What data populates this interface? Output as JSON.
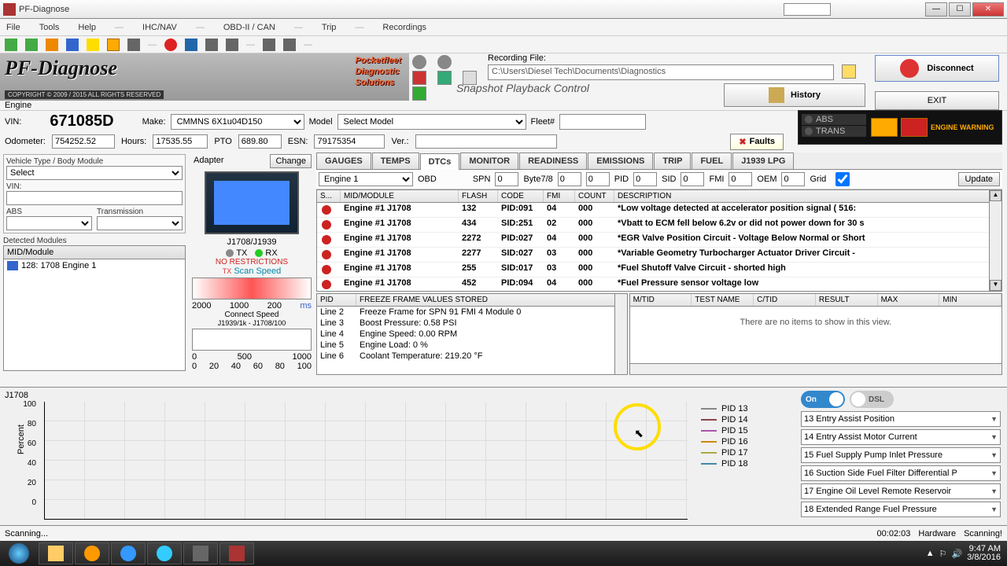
{
  "window": {
    "title": "PF-Diagnose"
  },
  "menus": [
    "File",
    "Tools",
    "Help",
    "IHC/NAV",
    "OBD-II / CAN",
    "Trip",
    "Recordings"
  ],
  "logo": {
    "main": "PF-Diagnose",
    "sub1": "Pocketfleet",
    "sub2": "Diagnostic",
    "sub3": "Solutions",
    "copy": "COPYRIGHT © 2009 / 2015  ALL RIGHTS RESERVED"
  },
  "rec": {
    "label": "Recording File:",
    "path": "C:\\Users\\Diesel Tech\\Documents\\Diagnostics",
    "snap": "Snapshot Playback Control"
  },
  "btns": {
    "disconnect": "Disconnect",
    "history": "History",
    "exit": "EXIT",
    "faults": "Faults",
    "update": "Update",
    "change": "Change"
  },
  "engine_lbl": "Engine",
  "vehicle": {
    "vin_lbl": "VIN:",
    "vin": "671085D",
    "make_lbl": "Make:",
    "make": "CMMNS 6X1u04D150",
    "model_lbl": "Model",
    "model": "Select Model",
    "fleet_lbl": "Fleet#",
    "odo_lbl": "Odometer:",
    "odo": "754252.52",
    "hours_lbl": "Hours:",
    "hours": "17535.55",
    "pto_lbl": "PTO",
    "pto": "689.80",
    "esn_lbl": "ESN:",
    "esn": "79175354",
    "ver_lbl": "Ver.:"
  },
  "ind": {
    "abs": "ABS",
    "trans": "TRANS",
    "ew": "ENGINE WARNING"
  },
  "left": {
    "vt_lbl": "Vehicle Type / Body Module",
    "vt": "Select",
    "vin_lbl": "VIN:",
    "abs": "ABS",
    "trans": "Transmission",
    "det": "Detected Modules",
    "mod_hdr": "MID/Module",
    "mod1": "128: 1708 Engine 1"
  },
  "adapter": {
    "lbl": "Adapter",
    "name": "J1708/J1939",
    "tx": "TX",
    "rx": "RX",
    "nr": "NO RESTRICTIONS",
    "ss": "Scan Speed",
    "g1": [
      "2000",
      "1000",
      "200"
    ],
    "cs": "Connect Speed",
    "cs2": "J1939/1k - J1708/100",
    "g2": [
      "0",
      "500",
      "1000"
    ],
    "g2b": [
      "0",
      "20",
      "40",
      "60",
      "80",
      "100"
    ]
  },
  "tabs": [
    "GAUGES",
    "TEMPS",
    "DTCs",
    "MONITOR",
    "READINESS",
    "EMISSIONS",
    "TRIP",
    "FUEL",
    "J1939 LPG"
  ],
  "active_tab": 2,
  "filt": {
    "eng": "Engine 1",
    "obd": "OBD",
    "spn": "SPN",
    "b78": "Byte7/8",
    "pid": "PID",
    "sid": "SID",
    "fmi": "FMI",
    "oem": "OEM",
    "grid": "Grid",
    "z": "0"
  },
  "dtc_hdr": [
    "S...",
    "MID/MODULE",
    "FLASH",
    "CODE",
    "FMI",
    "COUNT",
    "DESCRIPTION"
  ],
  "dtcs": [
    {
      "m": "Engine #1 J1708",
      "f": "132",
      "c": "PID:091",
      "fmi": "04",
      "cn": "000",
      "d": "*Low voltage detected at accelerator position signal ( 516:"
    },
    {
      "m": "Engine #1 J1708",
      "f": "434",
      "c": "SID:251",
      "fmi": "02",
      "cn": "000",
      "d": "*Vbatt to ECM fell below 6.2v or did not power down for 30 s"
    },
    {
      "m": "Engine #1 J1708",
      "f": "2272",
      "c": "PID:027",
      "fmi": "04",
      "cn": "000",
      "d": "*EGR Valve Position Circuit - Voltage Below Normal or Short"
    },
    {
      "m": "Engine #1 J1708",
      "f": "2277",
      "c": "SID:027",
      "fmi": "03",
      "cn": "000",
      "d": "*Variable Geometry Turbocharger Actuator Driver Circuit -"
    },
    {
      "m": "Engine #1 J1708",
      "f": "255",
      "c": "SID:017",
      "fmi": "03",
      "cn": "000",
      "d": "*Fuel Shutoff Valve Circuit - shorted high"
    },
    {
      "m": "Engine #1 J1708",
      "f": "452",
      "c": "PID:094",
      "fmi": "04",
      "cn": "000",
      "d": "*Fuel Pressure sensor voltage low"
    }
  ],
  "ff_hdr": [
    "PID",
    "FREEZE FRAME VALUES STORED"
  ],
  "ff": [
    {
      "l": "Line 2",
      "v": "Freeze Frame for SPN 91 FMI 4 Module 0"
    },
    {
      "l": "Line 3",
      "v": "Boost Pressure: 0.58 PSI"
    },
    {
      "l": "Line 4",
      "v": "Engine Speed: 0.00 RPM"
    },
    {
      "l": "Line 5",
      "v": "Engine Load: 0 %"
    },
    {
      "l": "Line 6",
      "v": "Coolant Temperature: 219.20 °F"
    }
  ],
  "tests_hdr": [
    "M/TID",
    "TEST NAME",
    "C/TID",
    "RESULT",
    "MAX",
    "MIN"
  ],
  "tests_empty": "There are no items to show in this view.",
  "chart": {
    "title": "J1708",
    "ylabel": "Percent",
    "yticks": [
      "100",
      "80",
      "60",
      "40",
      "20",
      "0"
    ],
    "legend": [
      {
        "n": "PID 13",
        "c": "#888"
      },
      {
        "n": "PID 14",
        "c": "#844"
      },
      {
        "n": "PID 15",
        "c": "#a5a"
      },
      {
        "n": "PID 16",
        "c": "#c80"
      },
      {
        "n": "PID 17",
        "c": "#aa4"
      },
      {
        "n": "PID 18",
        "c": "#48a"
      }
    ]
  },
  "chart_data": {
    "type": "line",
    "ylabel": "Percent",
    "ylim": [
      0,
      100
    ],
    "series": [
      {
        "name": "PID 13",
        "values": []
      },
      {
        "name": "PID 14",
        "values": []
      },
      {
        "name": "PID 15",
        "values": []
      },
      {
        "name": "PID 16",
        "values": []
      },
      {
        "name": "PID 17",
        "values": []
      },
      {
        "name": "PID 18",
        "values": []
      }
    ]
  },
  "toggles": {
    "on": "On",
    "dsl": "DSL"
  },
  "pids": [
    "13 Entry Assist Position",
    "14 Entry Assist Motor Current",
    "15 Fuel Supply Pump Inlet Pressure",
    "16 Suction Side Fuel Filter Differential P",
    "17 Engine Oil Level Remote Reservoir",
    "18 Extended Range Fuel Pressure"
  ],
  "status": {
    "scan": "Scanning...",
    "time": "00:02:03",
    "hw": "Hardware",
    "st": "Scanning!"
  },
  "clock": {
    "t": "9:47 AM",
    "d": "3/8/2016"
  }
}
